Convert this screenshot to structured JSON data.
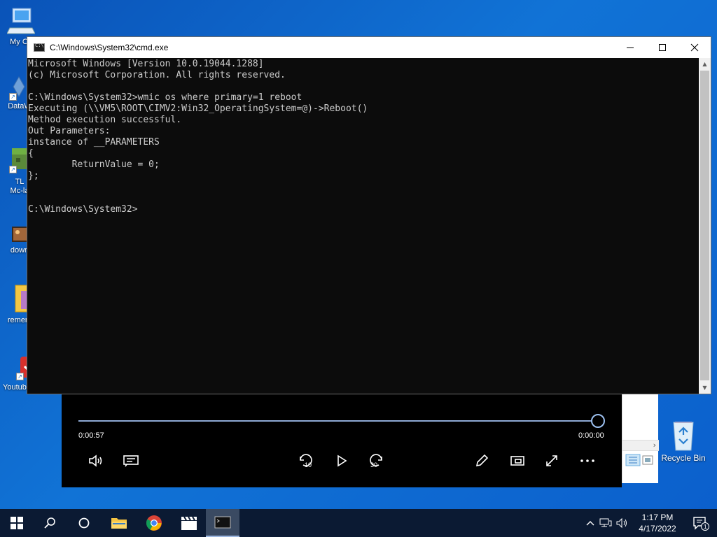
{
  "desktop": {
    "icons": [
      {
        "label": "My Co"
      },
      {
        "label": "DataW"
      },
      {
        "label": "TL"
      },
      {
        "label": "Mc-la"
      },
      {
        "label": "down"
      },
      {
        "label": "remem"
      },
      {
        "label": "Youtube-DL"
      }
    ],
    "recycle_bin": {
      "label": "Recycle Bin"
    }
  },
  "cmd_window": {
    "title": "C:\\Windows\\System32\\cmd.exe",
    "lines": [
      "Microsoft Windows [Version 10.0.19044.1288]",
      "(c) Microsoft Corporation. All rights reserved.",
      "",
      "C:\\Windows\\System32>wmic os where primary=1 reboot",
      "Executing (\\\\VM5\\ROOT\\CIMV2:Win32_OperatingSystem=@)->Reboot()",
      "Method execution successful.",
      "Out Parameters:",
      "instance of __PARAMETERS",
      "{",
      "        ReturnValue = 0;",
      "};",
      "",
      "",
      "C:\\Windows\\System32>"
    ]
  },
  "media_player": {
    "elapsed": "0:00:57",
    "remaining": "0:00:00",
    "progress": 1.0,
    "skip_back_label": "10",
    "skip_forward_label": "30"
  },
  "taskbar": {
    "time": "1:17 PM",
    "date": "4/17/2022",
    "notification_count": "1"
  },
  "colors": {
    "console_bg": "#0c0c0c",
    "console_text": "#cccccc",
    "taskbar": "#0b1a33",
    "desktop": "#1173d6"
  }
}
